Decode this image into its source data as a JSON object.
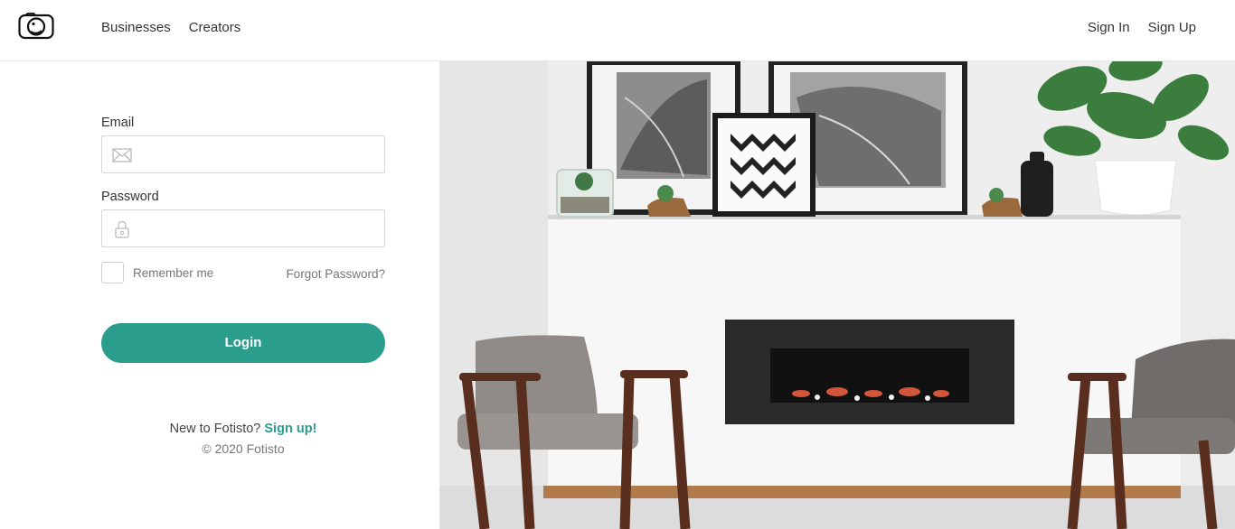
{
  "header": {
    "nav_left": [
      "Businesses",
      "Creators"
    ],
    "nav_right": [
      "Sign In",
      "Sign Up"
    ]
  },
  "form": {
    "email_label": "Email",
    "email_value": "",
    "password_label": "Password",
    "password_value": "",
    "remember_label": "Remember me",
    "remember_checked": false,
    "forgot_label": "Forgot Password?",
    "login_label": "Login"
  },
  "footer": {
    "new_text": "New to Fotisto?",
    "signup_text": "Sign up!",
    "copyright": "© 2020 Fotisto"
  },
  "colors": {
    "accent": "#2a9d8c",
    "border": "#d6d6d6"
  }
}
